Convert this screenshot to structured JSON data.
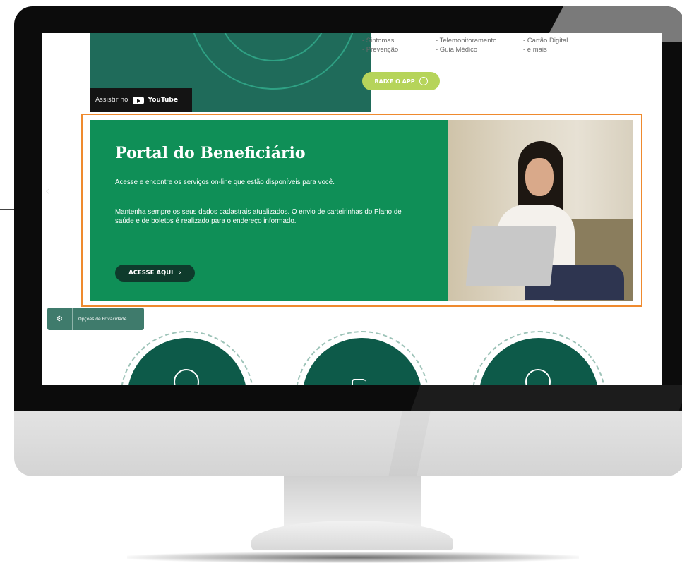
{
  "video": {
    "watch_on_label": "Assistir no",
    "platform_label": "YouTube"
  },
  "features": {
    "col1": [
      "- Sintomas",
      "- Prevenção"
    ],
    "col2": [
      "- Telemonitoramento",
      "- Guia Médico"
    ],
    "col3": [
      "- Cartão Digital",
      "- e mais"
    ]
  },
  "app_button": {
    "label": "BAIXE O APP"
  },
  "banner": {
    "title": "Portal do Beneficiário",
    "paragraph1": "Acesse e encontre os serviços on-line que estão disponíveis para você.",
    "paragraph2": "Mantenha sempre os seus dados cadastrais atualizados. O envio de carteirinhas do Plano de saúde e de boletos é realizado para o endereço informado.",
    "cta_label": "ACESSE AQUI"
  },
  "privacy": {
    "label": "Opções de Privacidade"
  },
  "colors": {
    "brand_green": "#0f8f57",
    "dark_green": "#0e3b2c",
    "lime": "#b6d45a",
    "highlight_orange": "#ef8a2e",
    "teal_dark": "#0d5a49"
  }
}
